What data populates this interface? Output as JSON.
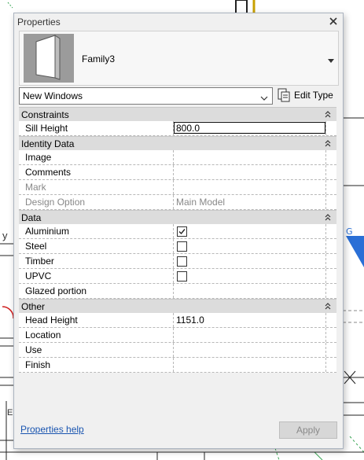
{
  "palette": {
    "title": "Properties",
    "family_name": "Family3",
    "type_selector": {
      "value": "New Windows"
    },
    "edit_type_label": "Edit Type",
    "help_link": "Properties help",
    "apply_label": "Apply",
    "apply_enabled": false
  },
  "sections": [
    {
      "label": "Constraints",
      "rows": [
        {
          "name": "Sill Height",
          "value": "800.0",
          "kind": "input"
        }
      ]
    },
    {
      "label": "Identity Data",
      "rows": [
        {
          "name": "Image",
          "value": "",
          "kind": "text"
        },
        {
          "name": "Comments",
          "value": "",
          "kind": "text"
        },
        {
          "name": "Mark",
          "value": "",
          "kind": "text",
          "disabled": true
        },
        {
          "name": "Design Option",
          "value": "Main Model",
          "kind": "text",
          "disabled": true
        }
      ]
    },
    {
      "label": "Data",
      "rows": [
        {
          "name": "Aluminium",
          "checked": true,
          "kind": "checkbox"
        },
        {
          "name": "Steel",
          "checked": false,
          "kind": "checkbox"
        },
        {
          "name": "Timber",
          "checked": false,
          "kind": "checkbox"
        },
        {
          "name": "UPVC",
          "checked": false,
          "kind": "checkbox"
        },
        {
          "name": "Glazed portion",
          "value": "",
          "kind": "text"
        }
      ]
    },
    {
      "label": "Other",
      "rows": [
        {
          "name": "Head Height",
          "value": "1151.0",
          "kind": "text"
        },
        {
          "name": "Location",
          "value": "",
          "kind": "text"
        },
        {
          "name": "Use",
          "value": "",
          "kind": "text"
        },
        {
          "name": "Finish",
          "value": "",
          "kind": "text"
        }
      ]
    }
  ],
  "background_labels": {
    "left_fragment": "y",
    "bottom_left_fragment": "E"
  },
  "colors": {
    "link": "#1a55b0",
    "section_bg": "#dcdcdc",
    "accent_blue": "#2a6fd6",
    "accent_green": "#3aa655",
    "accent_red": "#d02020"
  }
}
